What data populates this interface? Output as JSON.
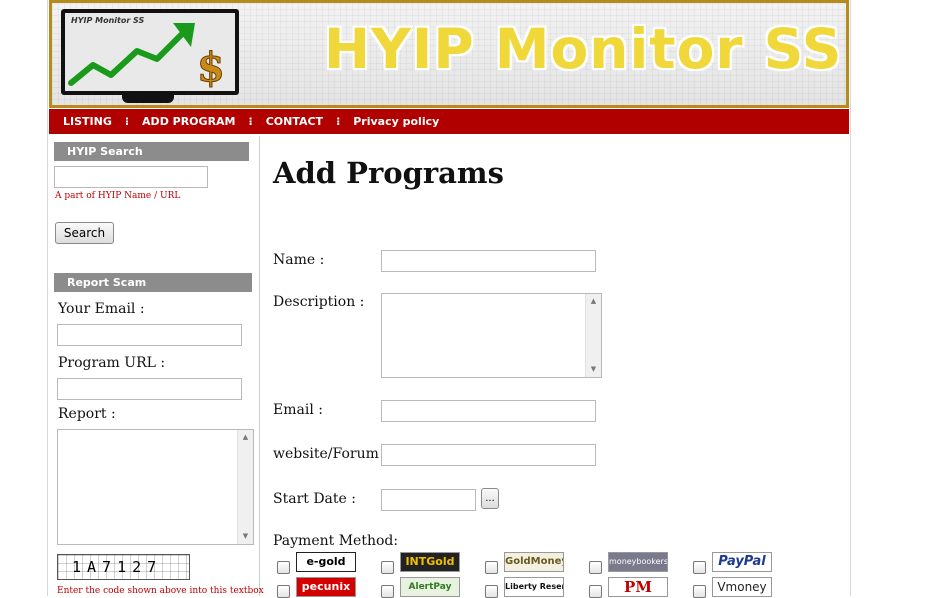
{
  "header": {
    "banner_title": "HYIP Monitor SS",
    "monitor_caption": "HYIP Monitor SS"
  },
  "nav": {
    "items": [
      "LISTING",
      "ADD PROGRAM",
      "CONTACT",
      "Privacy policy"
    ],
    "separator": "⁝"
  },
  "sidebar": {
    "search": {
      "heading": "HYIP Search",
      "input_value": "",
      "hint": "A part of HYIP Name / URL",
      "button_label": "Search"
    },
    "report": {
      "heading": "Report Scam",
      "email_label": "Your Email :",
      "email_value": "",
      "url_label": "Program URL :",
      "url_value": "",
      "report_label": "Report :",
      "report_value": "",
      "captcha_text": "1A7127",
      "captcha_hint": "Enter the code shown above into this textbox"
    }
  },
  "main": {
    "title": "Add Programs",
    "fields": {
      "name_label": "Name :",
      "description_label": "Description :",
      "email_label": "Email :",
      "website_label": "website/Forum :",
      "start_date_label": "Start Date :",
      "date_button": "..."
    },
    "payment": {
      "label": "Payment Method:",
      "methods": [
        "e-gold",
        "INTGold",
        "GoldMoney",
        "moneybookers",
        "PayPal",
        "pecunix",
        "AlertPay",
        "Liberty Reserve",
        "PM",
        "Vmoney"
      ]
    }
  },
  "colors": {
    "nav_bg": "#b00000",
    "sidebar_heading_bg": "#8c8c8c",
    "banner_border": "#b58b1e",
    "title_yellow": "#f0d73a",
    "hint_red": "#c00000"
  }
}
